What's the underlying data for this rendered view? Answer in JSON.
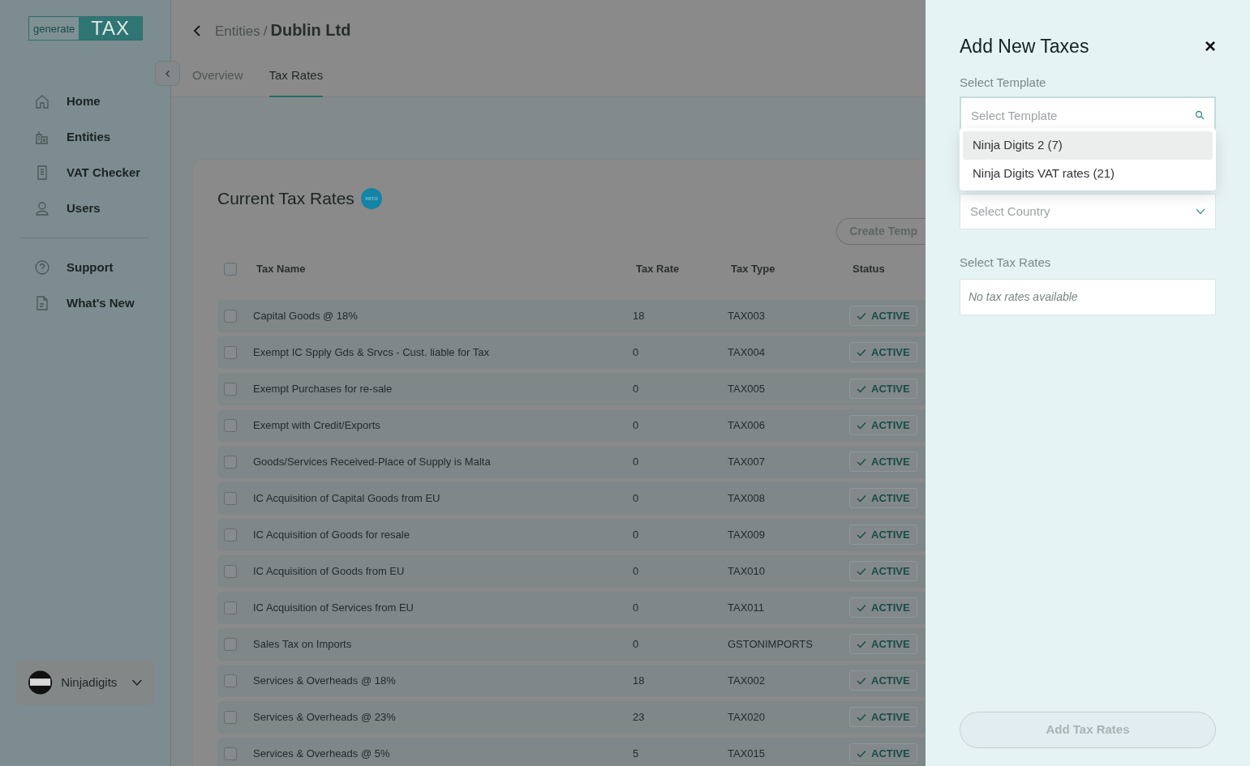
{
  "logo": {
    "left": "generate",
    "right": "TAX"
  },
  "sidebar": {
    "items": [
      {
        "label": "Home",
        "selected": false
      },
      {
        "label": "Entities",
        "selected": false
      },
      {
        "label": "VAT Checker",
        "selected": false
      },
      {
        "label": "Users",
        "selected": false
      }
    ],
    "footer_items": [
      {
        "label": "Support"
      },
      {
        "label": "What's New"
      }
    ],
    "account": {
      "name": "Ninjadigits"
    }
  },
  "breadcrumb": {
    "parent": "Entities",
    "separator": "/",
    "current": "Dublin Ltd"
  },
  "tabs": [
    {
      "label": "Overview",
      "selected": false
    },
    {
      "label": "Tax Rates",
      "selected": true
    }
  ],
  "card": {
    "title": "Current Tax Rates",
    "badge": "xero",
    "action": "Create Temp",
    "table": {
      "select_all_checked": false,
      "columns": [
        "Tax Name",
        "Tax Rate",
        "Tax Type",
        "Status"
      ],
      "rows": [
        {
          "name": "Capital Goods @ 18%",
          "rate": "18",
          "type": "TAX003",
          "status": "ACTIVE",
          "checked": false
        },
        {
          "name": "Exempt IC Spply Gds & Srvcs - Cust. liable for Tax",
          "rate": "0",
          "type": "TAX004",
          "status": "ACTIVE",
          "checked": false
        },
        {
          "name": "Exempt Purchases for re-sale",
          "rate": "0",
          "type": "TAX005",
          "status": "ACTIVE",
          "checked": false
        },
        {
          "name": "Exempt with Credit/Exports",
          "rate": "0",
          "type": "TAX006",
          "status": "ACTIVE",
          "checked": false
        },
        {
          "name": "Goods/Services Received-Place of Supply is Malta",
          "rate": "0",
          "type": "TAX007",
          "status": "ACTIVE",
          "checked": false
        },
        {
          "name": "IC Acquisition of Capital Goods from EU",
          "rate": "0",
          "type": "TAX008",
          "status": "ACTIVE",
          "checked": false
        },
        {
          "name": "IC Acquisition of Goods for resale",
          "rate": "0",
          "type": "TAX009",
          "status": "ACTIVE",
          "checked": false
        },
        {
          "name": "IC Acquisition of Goods from EU",
          "rate": "0",
          "type": "TAX010",
          "status": "ACTIVE",
          "checked": false
        },
        {
          "name": "IC Acquisition of Services from EU",
          "rate": "0",
          "type": "TAX011",
          "status": "ACTIVE",
          "checked": false
        },
        {
          "name": "Sales Tax on Imports",
          "rate": "0",
          "type": "GSTONIMPORTS",
          "status": "ACTIVE",
          "checked": false
        },
        {
          "name": "Services & Overheads @ 18%",
          "rate": "18",
          "type": "TAX002",
          "status": "ACTIVE",
          "checked": false
        },
        {
          "name": "Services & Overheads @ 23%",
          "rate": "23",
          "type": "TAX020",
          "status": "ACTIVE",
          "checked": false
        },
        {
          "name": "Services & Overheads @ 5%",
          "rate": "5",
          "type": "TAX015",
          "status": "ACTIVE",
          "checked": false
        }
      ]
    }
  },
  "panel": {
    "title": "Add New Taxes",
    "close": "×",
    "template_label": "Select Template",
    "template_placeholder": "Select Template",
    "template_options": [
      {
        "label": "Ninja Digits 2 (7)",
        "selected": true
      },
      {
        "label": "Ninja Digits VAT rates (21)",
        "selected": false
      }
    ],
    "country_placeholder": "Select Country",
    "rates_label": "Select Tax Rates",
    "rates_empty": "No tax rates available",
    "submit": {
      "label": "Add Tax Rates",
      "disabled": true
    }
  }
}
